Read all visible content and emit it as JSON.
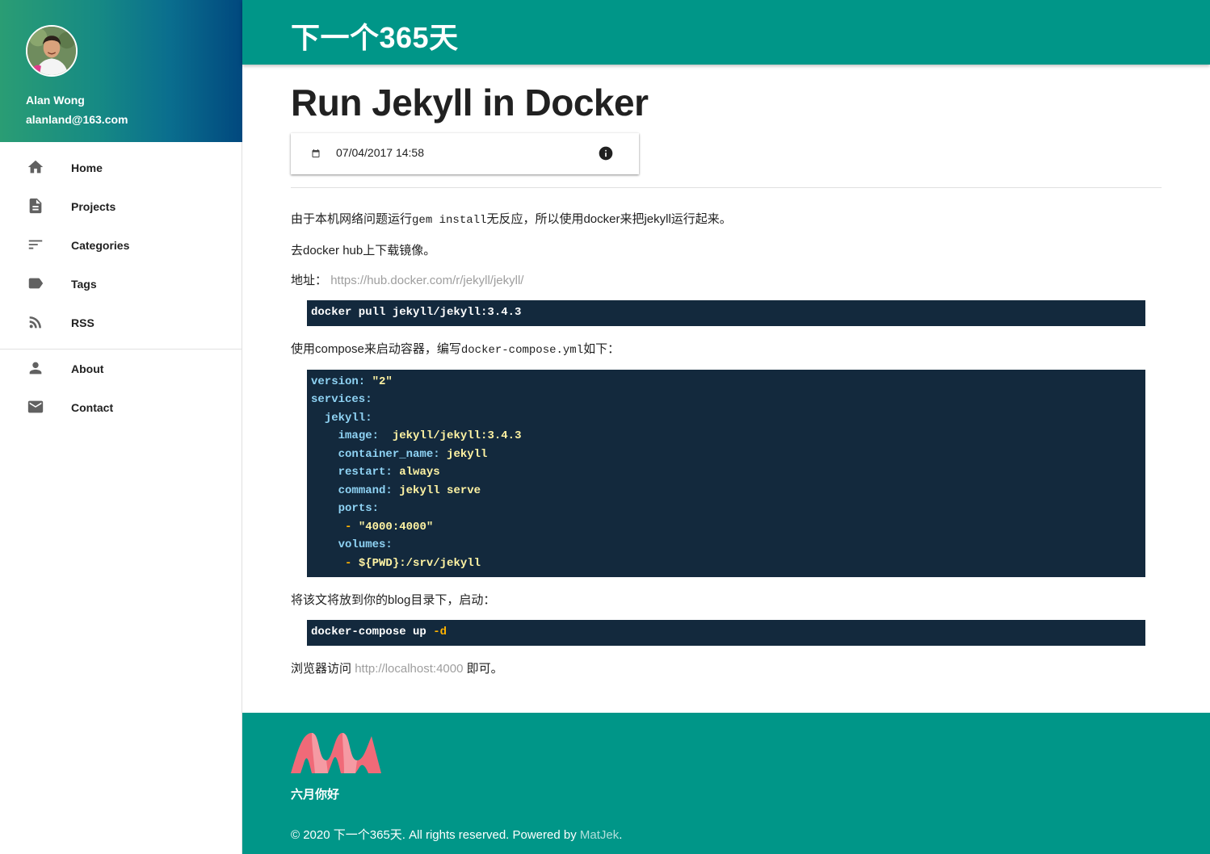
{
  "user": {
    "name": "Alan Wong",
    "email": "alanland@163.com"
  },
  "nav_primary": [
    {
      "label": "Home",
      "icon": "home-icon"
    },
    {
      "label": "Projects",
      "icon": "document-icon"
    },
    {
      "label": "Categories",
      "icon": "sort-icon"
    },
    {
      "label": "Tags",
      "icon": "label-icon"
    },
    {
      "label": "RSS",
      "icon": "rss-icon"
    }
  ],
  "nav_secondary": [
    {
      "label": "About",
      "icon": "person-icon"
    },
    {
      "label": "Contact",
      "icon": "email-icon"
    }
  ],
  "site": {
    "title": "下一个365天"
  },
  "post": {
    "title": "Run Jekyll in Docker",
    "date": "07/04/2017 14:58",
    "p1_before": "由于本机网络问题运行",
    "p1_code": "gem install",
    "p1_after": "无反应，所以使用docker来把jekyll运行起来。",
    "p2": "去docker hub上下载镜像。",
    "p3_label": "地址：",
    "p3_link": "https://hub.docker.com/r/jekyll/jekyll/",
    "code1": "docker pull jekyll/jekyll:3.4.3",
    "p4_before": "使用compose来启动容器，编写",
    "p4_code": "docker-compose.yml",
    "p4_after": "如下：",
    "compose": {
      "version_key": "version:",
      "version_val": "\"2\"",
      "services_key": "services:",
      "service_key": "jekyll:",
      "image_key": "image:",
      "image_val": "jekyll/jekyll:3.4.3",
      "container_key": "container_name:",
      "container_val": "jekyll",
      "restart_key": "restart:",
      "restart_val": "always",
      "command_key": "command:",
      "command_val": "jekyll serve",
      "ports_key": "ports:",
      "ports_dash": "-",
      "ports_val": "\"4000:4000\"",
      "volumes_key": "volumes:",
      "volumes_dash": "-",
      "volumes_val": "${PWD}:/srv/jekyll"
    },
    "p5": "将该文将放到你的blog目录下，启动：",
    "code3_cmd": "docker-compose up",
    "code3_flag": "-d",
    "p6_before": "浏览器访问",
    "p6_link": "http://localhost:4000",
    "p6_after": "即可。"
  },
  "footer": {
    "tagline": "六月你好",
    "copy_before": "© 2020 下一个365天. All rights reserved. Powered by",
    "copy_link": "MatJek",
    "copy_after": "."
  },
  "colors": {
    "primary": "#009688",
    "code_bg": "#13293d",
    "link": "#9e9e9e",
    "logo": "#f06a78"
  }
}
